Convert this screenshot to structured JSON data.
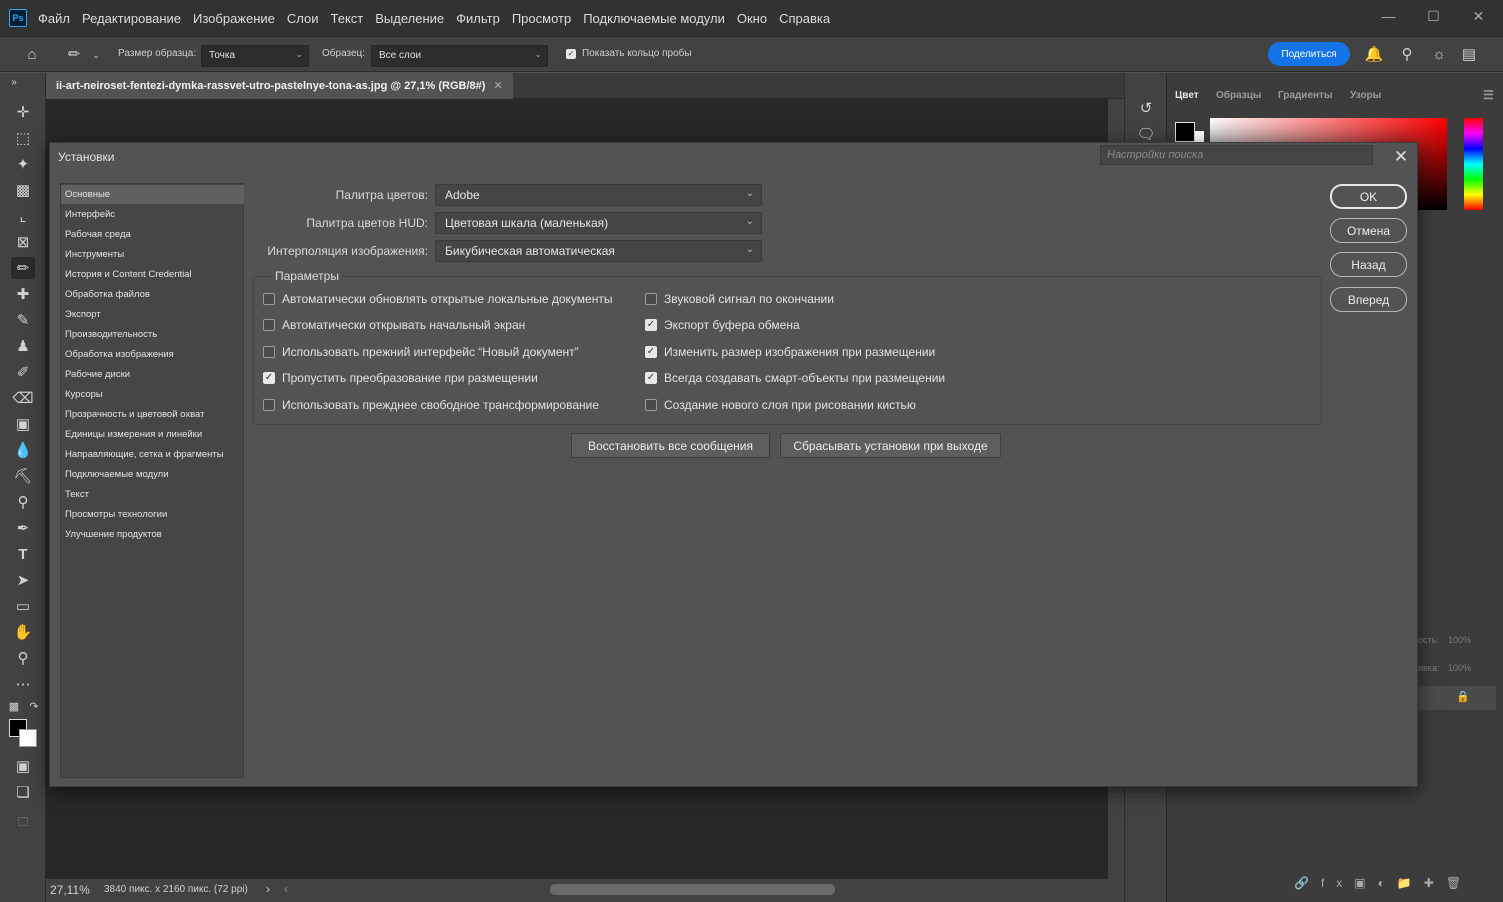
{
  "app": {
    "logo": "Ps"
  },
  "menu": [
    "Файл",
    "Редактирование",
    "Изображение",
    "Слои",
    "Текст",
    "Выделение",
    "Фильтр",
    "Просмотр",
    "Подключаемые модули",
    "Окно",
    "Справка"
  ],
  "options_bar": {
    "sample_size_label": "Размер образца:",
    "sample_size_value": "Точка",
    "sample_label": "Образец:",
    "sample_value": "Все слои",
    "show_ring_label": "Показать кольцо пробы",
    "show_ring_checked": true,
    "share_label": "Поделиться"
  },
  "document": {
    "tab_title": "ii-art-neiroset-fentezi-dymka-rassvet-utro-pastelnye-tona-as.jpg @ 27,1% (RGB/8#)",
    "zoom": "27,11%",
    "info": "3840 пикс. x 2160 пикс. (72 ppi)"
  },
  "panels": {
    "tabs": [
      "Цвет",
      "Образцы",
      "Градиенты",
      "Узоры"
    ],
    "active_tab": "Цвет",
    "dim_opacity_label": "ость:",
    "dim_opacity_value": "100%",
    "dim_fill_label": "ивка:",
    "dim_fill_value": "100%"
  },
  "dialog": {
    "title": "Установки",
    "search_placeholder": "Настройки поиска",
    "nav": [
      "Основные",
      "Интерфейс",
      "Рабочая среда",
      "Инструменты",
      "История и Content Credential",
      "Обработка файлов",
      "Экспорт",
      "Производительность",
      "Обработка изображения",
      "Рабочие диски",
      "Курсоры",
      "Прозрачность и цветовой охват",
      "Единицы измерения и линейки",
      "Направляющие, сетка и фрагменты",
      "Подключаемые модули",
      "Текст",
      "Просмотры технологии",
      "Улучшение продуктов"
    ],
    "nav_selected": 0,
    "fields": [
      {
        "label": "Палитра цветов:",
        "value": "Adobe"
      },
      {
        "label": "Палитра цветов HUD:",
        "value": "Цветовая шкала (маленькая)"
      },
      {
        "label": "Интерполяция изображения:",
        "value": "Бикубическая автоматическая"
      }
    ],
    "group_title": "Параметры",
    "options_left": [
      {
        "label": "Автоматически обновлять открытые локальные документы",
        "checked": false
      },
      {
        "label": "Автоматически открывать начальный экран",
        "checked": false
      },
      {
        "label": "Использовать прежний интерфейс “Новый документ”",
        "checked": false
      },
      {
        "label": "Пропустить преобразование при размещении",
        "checked": true
      },
      {
        "label": "Использовать прежднее свободное трансформирование",
        "checked": false
      }
    ],
    "options_right": [
      {
        "label": "Звуковой сигнал по окончании",
        "checked": false
      },
      {
        "label": "Экспорт буфера обмена",
        "checked": true
      },
      {
        "label": "Изменить размер изображения при размещении",
        "checked": true
      },
      {
        "label": "Всегда создавать смарт-объекты при размещении",
        "checked": true
      },
      {
        "label": "Создание нового слоя при рисовании кистью",
        "checked": false
      }
    ],
    "restore_messages": "Восстановить все сообщения",
    "reset_on_exit": "Сбрасывать установки при выходе",
    "buttons": {
      "ok": "OK",
      "cancel": "Отмена",
      "prev": "Назад",
      "next": "Вперед"
    }
  },
  "icons": [
    "home-icon",
    "eyedropper-icon",
    "bell-icon",
    "search-icon",
    "lightbulb-icon",
    "workspace-icon",
    "move-icon",
    "marquee-icon",
    "quick-select-icon",
    "crop-icon",
    "frame-icon",
    "eyedropper-tool-icon",
    "healing-icon",
    "brush-icon",
    "stamp-icon",
    "history-brush-icon",
    "eraser-icon",
    "gradient-icon",
    "blur-icon",
    "dodge-icon",
    "pen-icon",
    "type-icon",
    "path-select-icon",
    "rectangle-icon",
    "hand-icon",
    "zoom-icon",
    "more-icon",
    "close-icon"
  ],
  "colors": {
    "accent": "#1473e6",
    "bg": "#535353",
    "menubar": "#323232"
  }
}
